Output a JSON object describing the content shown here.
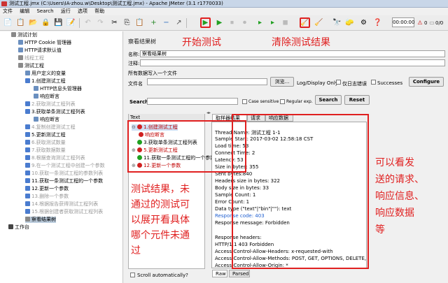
{
  "window": {
    "title": "测试工程.jmx (C:\\Users\\IA-zhou.w\\Desktop\\测试工程.jmx) - Apache JMeter (3.1 r1770033)"
  },
  "menu": [
    "文件",
    "编辑",
    "Search",
    "运行",
    "选项",
    "帮助"
  ],
  "toolbar": {
    "timer": "00:00:00",
    "count_left": "0",
    "count_right": "0/0"
  },
  "tree": [
    {
      "label": "测试计划",
      "icon": "plan"
    },
    {
      "label": "HTTP Cookie 管理器",
      "icon": "cfg"
    },
    {
      "label": "HTTP请求默认值",
      "icon": "cfg"
    },
    {
      "label": "线程工程",
      "icon": "grp",
      "dim": true
    },
    {
      "label": "测试工程",
      "icon": "grp"
    },
    {
      "label": "用户定义的变量",
      "icon": "cfg"
    },
    {
      "label": "1.创建测试工程",
      "icon": "smp"
    },
    {
      "label": "HTTP信息头管理器",
      "icon": "cfg"
    },
    {
      "label": "响应断言",
      "icon": "cfg"
    },
    {
      "label": "2.获取测试工程列表",
      "icon": "smp",
      "dim": true
    },
    {
      "label": "3.获取单条测试工程列表",
      "icon": "smp"
    },
    {
      "label": "响应断言",
      "icon": "cfg"
    },
    {
      "label": "4.复制创建测试工程",
      "icon": "smp",
      "dim": true
    },
    {
      "label": "5.更新测试工程",
      "icon": "smp"
    },
    {
      "label": "6.获取测试数量",
      "icon": "smp",
      "dim": true
    },
    {
      "label": "7.获取数据数量",
      "icon": "smp",
      "dim": true
    },
    {
      "label": "8.根据查询测试工程列表",
      "icon": "smp",
      "dim": true
    },
    {
      "label": "9.在一个测试工程中创建一个参数",
      "icon": "smp",
      "dim": true
    },
    {
      "label": "10.获取一条测试工程的参数列表",
      "icon": "smp",
      "dim": true
    },
    {
      "label": "11.获取一条测试工程的一个参数",
      "icon": "smp"
    },
    {
      "label": "12.更新一个参数",
      "icon": "smp"
    },
    {
      "label": "13.删除一个参数",
      "icon": "smp",
      "dim": true
    },
    {
      "label": "14.根据报告获得测试工程列表",
      "icon": "smp",
      "dim": true
    },
    {
      "label": "15.根据创建者获取测试工程列表",
      "icon": "smp",
      "dim": true
    },
    {
      "label": "察看结果树",
      "icon": "lst",
      "selected": true
    },
    {
      "label": "工作台",
      "icon": "wb"
    }
  ],
  "panel": {
    "title": "察看结果树",
    "name_label": "名称:",
    "name_value": "察看结果树",
    "comment_label": "注释:",
    "write_all_label": "所有数据写入一个文件",
    "filename_label": "文件名",
    "browse_button": "浏览...",
    "log_display_label": "Log/Display Only:",
    "only_errors_label": "仅日志错误",
    "successes_label": "Successes",
    "configure_button": "Configure",
    "search_label": "Search:",
    "case_sensitive_label": "Case sensitive",
    "regex_label": "Regular exp.",
    "search_button": "Search",
    "reset_button": "Reset",
    "text_header": "Text",
    "scroll_auto_label": "Scroll automatically?"
  },
  "results": [
    {
      "label": "1.创建测试工程",
      "status": "fail",
      "expandable": true
    },
    {
      "label": "响应断言",
      "status": "fail",
      "expandable": false
    },
    {
      "label": "3.获取单条测试工程列表",
      "status": "ok",
      "expandable": false
    },
    {
      "label": "5.更新测试工程",
      "status": "fail",
      "expandable": true
    },
    {
      "label": "11.获取一条测试工程的一个参数",
      "status": "ok",
      "expandable": false
    },
    {
      "label": "12.更新一个参数",
      "status": "fail",
      "expandable": true
    }
  ],
  "tabs": [
    "取样器结果",
    "请求",
    "响应数据"
  ],
  "detail": [
    {
      "text": "Thread Name: 测试工程 1-1"
    },
    {
      "text": "Sample Start: 2017-03-02 12:58:18 CST"
    },
    {
      "text": "Load time: 53"
    },
    {
      "text": "Connect Time: 2"
    },
    {
      "text": "Latency: 53"
    },
    {
      "text": "Size in bytes: 355"
    },
    {
      "text": "Sent bytes:840"
    },
    {
      "text": "Headers size in bytes: 322"
    },
    {
      "text": "Body size in bytes: 33"
    },
    {
      "text": "Sample Count: 1"
    },
    {
      "text": "Error Count: 1"
    },
    {
      "text": "Data type (\"text\"|\"bin\"|\"\"): text"
    },
    {
      "text": "Response code: 403",
      "blue": true
    },
    {
      "text": "Response message: Forbidden"
    },
    {
      "text": ""
    },
    {
      "text": "Response headers:"
    },
    {
      "text": "HTTP/1.1 403 Forbidden"
    },
    {
      "text": "Access-Control-Allow-Headers: x-requested-with"
    },
    {
      "text": "Access-Control-Allow-Methods: POST, GET, OPTIONS, DELETE, PUT"
    },
    {
      "text": "Access-Control-Allow-Origin: *"
    }
  ],
  "bottom_tabs": [
    "Raw",
    "Parsed"
  ],
  "annotations": {
    "start": "开始测试",
    "clear": "清除测试结果",
    "left": [
      "测试结果，未",
      "通过的测试可",
      "以展开看具体",
      "哪个元件未通",
      "过"
    ],
    "right": [
      "可以看发",
      "送的请求、",
      "响应信息、",
      "响应数据",
      "等"
    ]
  },
  "colors": {
    "annotation": "#e02020",
    "fail": "#c00000",
    "ok": "#20a020",
    "blue": "#1f5fd0"
  }
}
